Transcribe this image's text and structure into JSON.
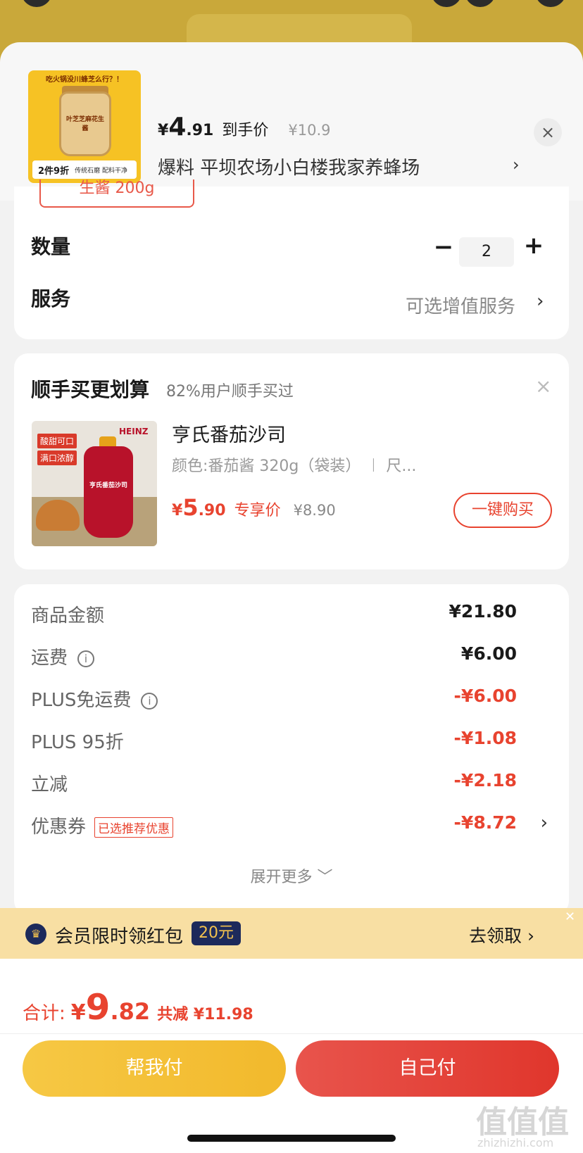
{
  "product": {
    "price_yen": "¥",
    "price_int": "4",
    "price_dec": ".91",
    "price_tag": "到手价",
    "price_original": "¥10.9",
    "description": "爆料  平坝农场小白楼我家养蜂场",
    "thumb_top_text": "吃火锅没川蜂芝么行？！",
    "thumb_jar_label": "叶芝芝麻花生酱",
    "thumb_badge": "2件9折",
    "thumb_badge_sub": "传统石磨 配料干净"
  },
  "spec": {
    "selected_chip": "生酱 200g"
  },
  "quantity": {
    "label": "数量",
    "value": "2",
    "minus": "−",
    "plus": "+"
  },
  "service": {
    "label": "服务",
    "value": "可选增值服务"
  },
  "addon": {
    "title": "顺手买更划算",
    "subtitle": "82%用户顺手买过",
    "product_name": "亨氏番茄沙司",
    "spec": "颜色:番茄酱 320g（袋装） ︱ 尺...",
    "price_yen": "¥",
    "price_int": "5",
    "price_dec": ".90",
    "price_tag": "专享价",
    "price_original": "¥8.90",
    "buy_button": "一键购买",
    "img_brand": "HEINZ",
    "img_tag1": "酸甜可口",
    "img_tag2": "满口浓醇",
    "img_pouch_label": "亨氏番茄沙司"
  },
  "fees": [
    {
      "label": "商品金额",
      "value": "¥21.80"
    },
    {
      "label": "运费",
      "value": "¥6.00"
    },
    {
      "label": "PLUS免运费",
      "value": "-¥6.00"
    },
    {
      "label": "PLUS 95折",
      "value": "-¥1.08"
    },
    {
      "label": "立减",
      "value": "-¥2.18"
    },
    {
      "label": "优惠券",
      "value": "-¥8.72",
      "badge": "已选推荐优惠"
    }
  ],
  "expand_label": "展开更多 ﹀",
  "promo": {
    "text": "会员限时领红包",
    "amount": "20元",
    "action": "去领取"
  },
  "total": {
    "label": "合计:",
    "yen": "¥",
    "int": "9",
    "dec": ".82",
    "saved": "共减 ¥11.98"
  },
  "buttons": {
    "help_pay": "帮我付",
    "self_pay": "自己付"
  },
  "watermark": {
    "main": "值值值",
    "sub": "zhizhizhi.com"
  },
  "colors": {
    "accent_red": "#e8432f",
    "gold": "#f6c844",
    "navy": "#1d2a5b"
  }
}
